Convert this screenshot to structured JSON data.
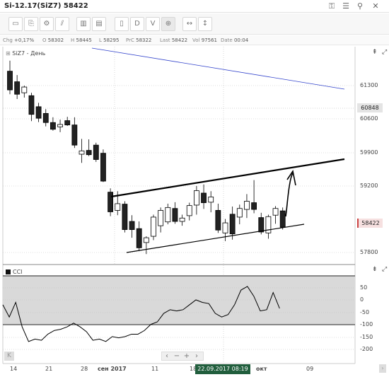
{
  "window": {
    "title": "Si-12.17(SiZ7) 58422",
    "icons": [
      "lock-icon",
      "menu-icon",
      "pin-icon",
      "close-icon"
    ]
  },
  "toolbar": {
    "buttons": [
      {
        "name": "new-chart-icon",
        "glyph": "▭"
      },
      {
        "name": "open-icon",
        "glyph": "⎘"
      },
      {
        "name": "settings-icon",
        "glyph": "⚙"
      },
      {
        "name": "draw-icon",
        "glyph": "⫽"
      },
      {
        "name": "bars-chart-icon",
        "glyph": "▥"
      },
      {
        "name": "volume-bars-icon",
        "glyph": "▤"
      },
      {
        "name": "candlestick-icon",
        "glyph": "▯"
      },
      {
        "name": "d-button",
        "glyph": "D"
      },
      {
        "name": "v-button",
        "glyph": "V"
      },
      {
        "name": "crosshair-icon",
        "glyph": "⊕"
      },
      {
        "name": "fit-width-icon",
        "glyph": "↔"
      },
      {
        "name": "fit-height-icon",
        "glyph": "↕"
      }
    ]
  },
  "infobar": {
    "chg_label": "Chg",
    "chg": "+0,17%",
    "open_label": "O",
    "open": "58302",
    "high_label": "H",
    "high": "58445",
    "low_label": "L",
    "low": "58295",
    "prc_label": "PrC",
    "prc": "58322",
    "last_label": "Last",
    "last": "58422",
    "vol_label": "Vol",
    "vol": "97561",
    "date_label": "Date",
    "date": "00:04"
  },
  "main_chart": {
    "legend": "SiZ7 - День",
    "y_labels": [
      "61300",
      "60600",
      "59900",
      "59200",
      "57800"
    ],
    "price_tag_grey": "60848",
    "price_tag_last": "58422",
    "colors": {
      "up": "#ffffff",
      "down": "#222222",
      "blue_line": "#3344cc",
      "bg": "#ffffff"
    }
  },
  "cci_panel": {
    "legend": "CCI",
    "y_labels": [
      "50",
      "0",
      "-50",
      "-100",
      "-150",
      "-200"
    ],
    "colors": {
      "band": "#d9d9d9",
      "line": "#000000"
    }
  },
  "x_axis": {
    "labels": [
      "14",
      "21",
      "28",
      "сен 2017",
      "11",
      "18",
      "окт",
      "09"
    ],
    "cursor_time": "22.09.2017 08:19"
  },
  "pan_controls": {
    "left": "‹",
    "minus": "−",
    "plus": "+",
    "right": "›"
  },
  "chart_data": {
    "type": "candlestick",
    "candles": [
      {
        "o": 61600,
        "h": 61820,
        "l": 61120,
        "c": 61210
      },
      {
        "o": 61380,
        "h": 61520,
        "l": 61020,
        "c": 61120
      },
      {
        "o": 61150,
        "h": 61300,
        "l": 61050,
        "c": 61270
      },
      {
        "o": 61090,
        "h": 61150,
        "l": 60560,
        "c": 60700
      },
      {
        "o": 60860,
        "h": 60940,
        "l": 60540,
        "c": 60620
      },
      {
        "o": 60720,
        "h": 60810,
        "l": 60450,
        "c": 60530
      },
      {
        "o": 60530,
        "h": 60640,
        "l": 60360,
        "c": 60390
      },
      {
        "o": 60440,
        "h": 60590,
        "l": 60330,
        "c": 60490
      },
      {
        "o": 60570,
        "h": 60650,
        "l": 60460,
        "c": 60480
      },
      {
        "o": 60480,
        "h": 60640,
        "l": 60000,
        "c": 60060
      },
      {
        "o": 59870,
        "h": 60190,
        "l": 59690,
        "c": 59940
      },
      {
        "o": 59950,
        "h": 60180,
        "l": 59830,
        "c": 59860
      },
      {
        "o": 60060,
        "h": 60110,
        "l": 59710,
        "c": 59760
      },
      {
        "o": 59890,
        "h": 59970,
        "l": 59290,
        "c": 59310
      },
      {
        "o": 59080,
        "h": 59160,
        "l": 58580,
        "c": 58670
      },
      {
        "o": 58700,
        "h": 59100,
        "l": 58600,
        "c": 58840
      },
      {
        "o": 58830,
        "h": 58890,
        "l": 58240,
        "c": 58300
      },
      {
        "o": 58470,
        "h": 58600,
        "l": 58130,
        "c": 58300
      },
      {
        "o": 58320,
        "h": 58470,
        "l": 57850,
        "c": 57920
      },
      {
        "o": 58030,
        "h": 58160,
        "l": 57790,
        "c": 58130
      },
      {
        "o": 58160,
        "h": 58610,
        "l": 58080,
        "c": 58560
      },
      {
        "o": 58380,
        "h": 58760,
        "l": 58240,
        "c": 58700
      },
      {
        "o": 58460,
        "h": 58840,
        "l": 58410,
        "c": 58760
      },
      {
        "o": 58740,
        "h": 58870,
        "l": 58420,
        "c": 58470
      },
      {
        "o": 58470,
        "h": 58610,
        "l": 58380,
        "c": 58540
      },
      {
        "o": 58590,
        "h": 58860,
        "l": 58490,
        "c": 58800
      },
      {
        "o": 58810,
        "h": 59210,
        "l": 58610,
        "c": 59110
      },
      {
        "o": 59060,
        "h": 59240,
        "l": 58730,
        "c": 58860
      },
      {
        "o": 58870,
        "h": 59100,
        "l": 58660,
        "c": 58980
      },
      {
        "o": 58700,
        "h": 58840,
        "l": 58230,
        "c": 58290
      },
      {
        "o": 58230,
        "h": 58520,
        "l": 58060,
        "c": 58440
      },
      {
        "o": 58620,
        "h": 58780,
        "l": 58090,
        "c": 58210
      },
      {
        "o": 58560,
        "h": 58820,
        "l": 58410,
        "c": 58740
      },
      {
        "o": 58720,
        "h": 59040,
        "l": 58540,
        "c": 58890
      },
      {
        "o": 58860,
        "h": 59330,
        "l": 58640,
        "c": 58720
      },
      {
        "o": 58550,
        "h": 58650,
        "l": 58200,
        "c": 58250
      },
      {
        "o": 58230,
        "h": 58610,
        "l": 58110,
        "c": 58570
      },
      {
        "o": 58600,
        "h": 58790,
        "l": 58420,
        "c": 58740
      },
      {
        "o": 58690,
        "h": 58760,
        "l": 58300,
        "c": 58350
      }
    ],
    "cci": [
      -20,
      -70,
      -10,
      -110,
      -170,
      -160,
      -165,
      -140,
      -125,
      -120,
      -110,
      -95,
      -110,
      -130,
      -165,
      -160,
      -170,
      -150,
      -155,
      -150,
      -140,
      -140,
      -125,
      -100,
      -90,
      -55,
      -40,
      -45,
      -40,
      -20,
      0,
      -10,
      -15,
      -55,
      -70,
      -60,
      -20,
      40,
      55,
      15,
      -45,
      -40,
      30,
      -35
    ]
  }
}
